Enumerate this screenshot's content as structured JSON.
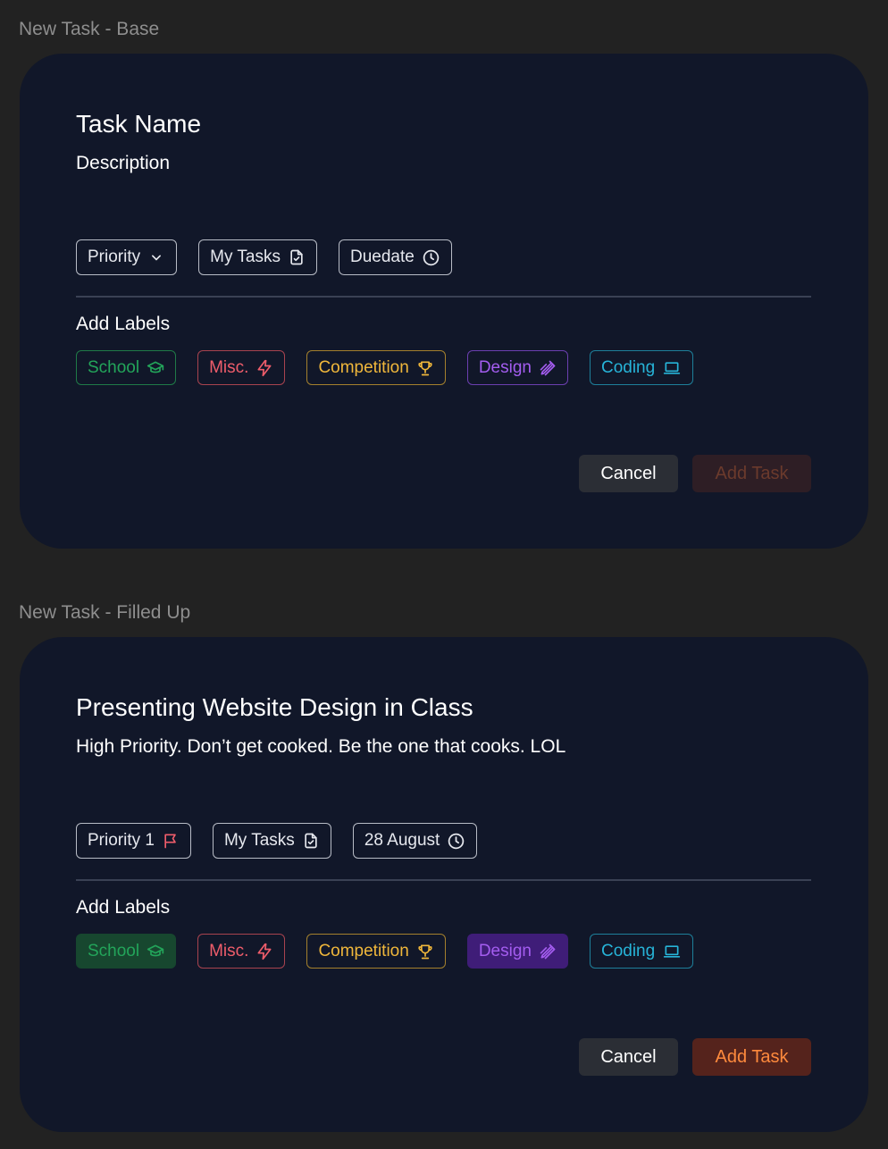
{
  "frames": [
    {
      "frame_label": "New Task - Base",
      "title": "Task Name",
      "description": "Description",
      "meta": {
        "priority": "Priority",
        "priority_icon": "chevron-down-icon",
        "project": "My Tasks",
        "project_icon": "file-check-icon",
        "due": "Duedate",
        "due_icon": "clock-icon"
      },
      "labels_heading": "Add Labels",
      "labels": [
        {
          "text": "School",
          "icon": "graduation-cap-icon",
          "color": "#23a55a",
          "selected": false
        },
        {
          "text": "Misc.",
          "icon": "lightning-icon",
          "color": "#ef5d6b",
          "selected": false
        },
        {
          "text": "Competition",
          "icon": "trophy-icon",
          "color": "#f0b73b",
          "selected": false
        },
        {
          "text": "Design",
          "icon": "pencil-ruler-icon",
          "color": "#a45df0",
          "selected": false
        },
        {
          "text": "Coding",
          "icon": "laptop-icon",
          "color": "#27b4d8",
          "selected": false
        }
      ],
      "buttons": {
        "cancel": "Cancel",
        "add": "Add Task",
        "add_enabled": false
      }
    },
    {
      "frame_label": "New Task - Filled Up",
      "title": "Presenting Website Design in Class",
      "description": "High Priority. Don’t get cooked. Be the one that cooks. LOL",
      "meta": {
        "priority": "Priority 1",
        "priority_icon": "flag-icon",
        "priority_icon_color": "#ef5d6b",
        "project": "My Tasks",
        "project_icon": "file-check-icon",
        "due": "28 August",
        "due_icon": "clock-icon"
      },
      "labels_heading": "Add Labels",
      "labels": [
        {
          "text": "School",
          "icon": "graduation-cap-icon",
          "color": "#23a55a",
          "selected": true
        },
        {
          "text": "Misc.",
          "icon": "lightning-icon",
          "color": "#ef5d6b",
          "selected": false
        },
        {
          "text": "Competition",
          "icon": "trophy-icon",
          "color": "#f0b73b",
          "selected": false
        },
        {
          "text": "Design",
          "icon": "pencil-ruler-icon",
          "color": "#a45df0",
          "selected": true
        },
        {
          "text": "Coding",
          "icon": "laptop-icon",
          "color": "#27b4d8",
          "selected": false
        }
      ],
      "buttons": {
        "cancel": "Cancel",
        "add": "Add Task",
        "add_enabled": true
      }
    }
  ]
}
